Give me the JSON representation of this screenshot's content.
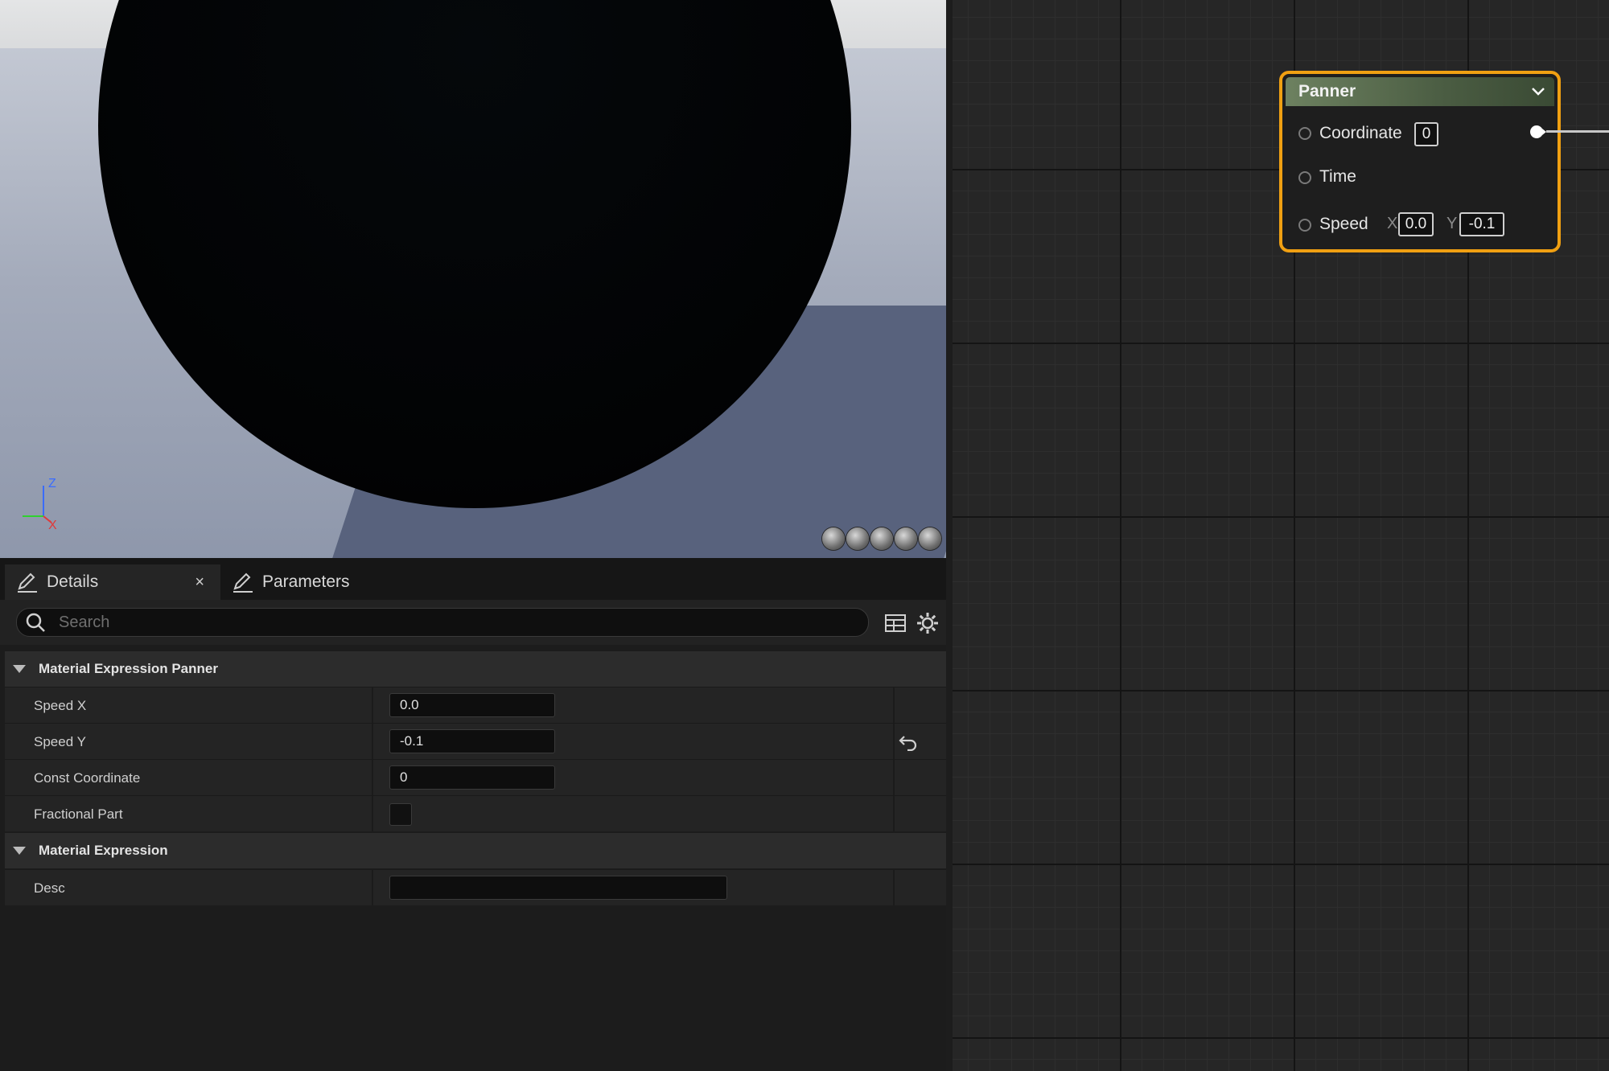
{
  "viewport": {
    "axis_z": "Z",
    "axis_x": "X",
    "preview_shapes": [
      "cylinder-icon",
      "sphere-icon",
      "plane-icon",
      "cube-icon",
      "custom-mesh-icon"
    ]
  },
  "details_panel": {
    "tabs": [
      {
        "label": "Details",
        "icon": "pencil-icon",
        "close": "×"
      },
      {
        "label": "Parameters",
        "icon": "pencil-icon"
      }
    ],
    "search": {
      "placeholder": "Search",
      "value": ""
    },
    "sections": [
      {
        "title": "Material Expression Panner",
        "rows": [
          {
            "label": "Speed X",
            "value": "0.0"
          },
          {
            "label": "Speed Y",
            "value": "-0.1"
          },
          {
            "label": "Const Coordinate",
            "value": "0"
          },
          {
            "label": "Fractional Part",
            "checked": false
          }
        ]
      },
      {
        "title": "Material Expression",
        "rows": [
          {
            "label": "Desc",
            "value": ""
          }
        ]
      }
    ]
  },
  "graph": {
    "node": {
      "title": "Panner",
      "pins": [
        {
          "label": "Coordinate",
          "value": "0"
        },
        {
          "label": "Time"
        },
        {
          "label": "Speed",
          "x_label": "X",
          "x_value": "0.0",
          "y_label": "Y",
          "y_value": "-0.1"
        }
      ]
    }
  },
  "colors": {
    "node_selection": "#f0a012",
    "node_header": "#5a6e50",
    "graph_bg": "#262626"
  }
}
